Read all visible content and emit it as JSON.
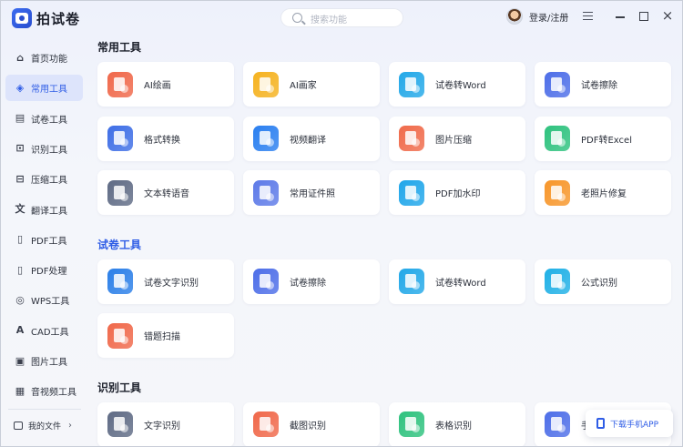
{
  "app": {
    "title": "拍试卷",
    "search_placeholder": "搜索功能",
    "login_label": "登录/注册"
  },
  "sidebar": {
    "items": [
      {
        "label": "首页功能",
        "icon": "home-icon",
        "glyph": "⌂",
        "active": false
      },
      {
        "label": "常用工具",
        "icon": "layers-icon",
        "glyph": "◈",
        "active": true
      },
      {
        "label": "试卷工具",
        "icon": "paper-icon",
        "glyph": "▤",
        "active": false
      },
      {
        "label": "识别工具",
        "icon": "scan-icon",
        "glyph": "⊡",
        "active": false
      },
      {
        "label": "压缩工具",
        "icon": "compress-icon",
        "glyph": "⊟",
        "active": false
      },
      {
        "label": "翻译工具",
        "icon": "translate-icon",
        "glyph": "文",
        "active": false
      },
      {
        "label": "PDF工具",
        "icon": "pdf-icon",
        "glyph": "▯",
        "active": false
      },
      {
        "label": "PDF处理",
        "icon": "pdf-process-icon",
        "glyph": "▯",
        "active": false
      },
      {
        "label": "WPS工具",
        "icon": "wps-icon",
        "glyph": "◎",
        "active": false
      },
      {
        "label": "CAD工具",
        "icon": "cad-icon",
        "glyph": "A",
        "active": false
      },
      {
        "label": "图片工具",
        "icon": "image-icon",
        "glyph": "▣",
        "active": false
      },
      {
        "label": "音视频工具",
        "icon": "media-icon",
        "glyph": "▦",
        "active": false
      }
    ],
    "my_files": "我的文件"
  },
  "sections": [
    {
      "title": "常用工具",
      "highlight": false,
      "tools": [
        {
          "label": "AI绘画",
          "icon": "ai-paint-icon",
          "color": "#f0684a"
        },
        {
          "label": "AI画家",
          "icon": "ai-artist-icon",
          "color": "#f5b21f"
        },
        {
          "label": "试卷转Word",
          "icon": "paper-to-word-icon",
          "color": "#22a8e8"
        },
        {
          "label": "试卷擦除",
          "icon": "paper-erase-icon",
          "color": "#4d6ee8"
        },
        {
          "label": "格式转换",
          "icon": "format-convert-icon",
          "color": "#3e6ee6"
        },
        {
          "label": "视频翻译",
          "icon": "video-translate-icon",
          "color": "#2a7ff0"
        },
        {
          "label": "图片压缩",
          "icon": "image-compress-icon",
          "color": "#f06a4a"
        },
        {
          "label": "PDF转Excel",
          "icon": "pdf-to-excel-icon",
          "color": "#2ec27e"
        },
        {
          "label": "文本转语音",
          "icon": "text-to-speech-icon",
          "color": "#5f6b85"
        },
        {
          "label": "常用证件照",
          "icon": "id-photo-icon",
          "color": "#5d7ae8"
        },
        {
          "label": "PDF加水印",
          "icon": "pdf-watermark-icon",
          "color": "#1fa6ea"
        },
        {
          "label": "老照片修复",
          "icon": "photo-restore-icon",
          "color": "#f7962a"
        }
      ]
    },
    {
      "title": "试卷工具",
      "highlight": true,
      "tools": [
        {
          "label": "试卷文字识别",
          "icon": "paper-ocr-icon",
          "color": "#2b7fe8"
        },
        {
          "label": "试卷擦除",
          "icon": "paper-erase-icon",
          "color": "#4d6ee8"
        },
        {
          "label": "试卷转Word",
          "icon": "paper-to-word-icon",
          "color": "#22a8e8"
        },
        {
          "label": "公式识别",
          "icon": "formula-ocr-icon",
          "color": "#1fb0e6"
        },
        {
          "label": "错题扫描",
          "icon": "wrong-question-scan-icon",
          "color": "#f0684a"
        }
      ]
    },
    {
      "title": "识别工具",
      "highlight": false,
      "tools": [
        {
          "label": "文字识别",
          "icon": "text-ocr-icon",
          "color": "#5f6b85"
        },
        {
          "label": "截图识别",
          "icon": "screenshot-ocr-icon",
          "color": "#f0684a"
        },
        {
          "label": "表格识别",
          "icon": "table-ocr-icon",
          "color": "#2ec27e"
        },
        {
          "label": "手",
          "icon": "handwriting-ocr-icon",
          "color": "#4d6ee8"
        }
      ]
    }
  ],
  "download_app": "下载手机APP"
}
